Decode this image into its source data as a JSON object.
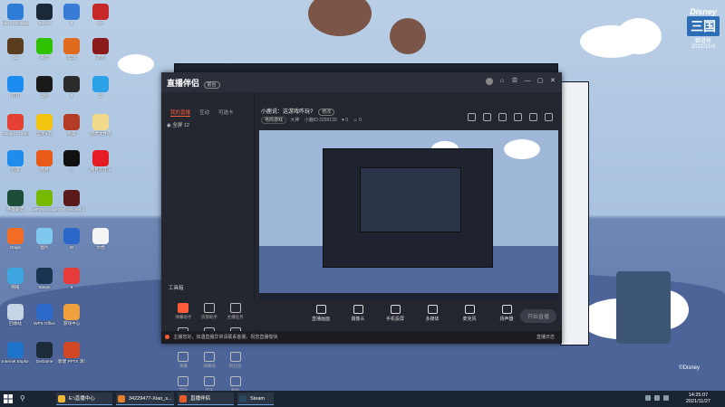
{
  "wallpaper": {
    "brand_line1": "Disney",
    "brand_line2": "三国",
    "brand_line3": "御道将",
    "brand_date": "2021/11/4",
    "copyright": "©Disney"
  },
  "desktop_icons": [
    {
      "label": "Microsoft Edge",
      "color": "#2f7cd6"
    },
    {
      "label": "Steam",
      "color": "#1b2838"
    },
    {
      "label": "8",
      "color": "#3a7bd5"
    },
    {
      "label": "CF",
      "color": "#c62828"
    },
    {
      "label": "SE",
      "color": "#5c3d1e"
    },
    {
      "label": "微信",
      "color": "#2dc100"
    },
    {
      "label": "篮球",
      "color": "#e06b1f"
    },
    {
      "label": "游戏",
      "color": "#8b1a1a"
    },
    {
      "label": "钉钉",
      "color": "#1c8cf0"
    },
    {
      "label": "QQ",
      "color": "#1a1a1a"
    },
    {
      "label": "5",
      "color": "#2b2b2b"
    },
    {
      "label": "Q",
      "color": "#2da1e6"
    },
    {
      "label": "Google Chrome",
      "color": "#e44134"
    },
    {
      "label": "全民K歌",
      "color": "#f2c40f"
    },
    {
      "label": "英雄",
      "color": "#b43c25"
    },
    {
      "label": "新建文件夹",
      "color": "#f3d98a"
    },
    {
      "label": "迅雷",
      "color": "#1f8ceb"
    },
    {
      "label": "网易",
      "color": "#e85a16"
    },
    {
      "label": "C",
      "color": "#111111"
    },
    {
      "label": "网易云音乐",
      "color": "#e51c23"
    },
    {
      "label": "英雄联盟",
      "color": "#1d4e3a"
    },
    {
      "label": "GeForce Experience",
      "color": "#76b900"
    },
    {
      "label": "The Witcher 3",
      "color": "#5a1a1a"
    },
    {
      "label": "WPS",
      "color": "#eeeeee"
    },
    {
      "label": "Origin",
      "color": "#f26c23"
    },
    {
      "label": "图片",
      "color": "#7ec8f0"
    },
    {
      "label": "W",
      "color": "#2b66c9"
    },
    {
      "label": "文档",
      "color": "#f5f5f5"
    },
    {
      "label": "网络",
      "color": "#3da5e0"
    },
    {
      "label": "Steam",
      "color": "#1a3350"
    },
    {
      "label": "6",
      "color": "#e63c3c"
    },
    {
      "label": "回收站",
      "color": "#c7d4e6"
    },
    {
      "label": "WPS Office",
      "color": "#2e6ac9"
    },
    {
      "label": "游戏中心",
      "color": "#f0a03c"
    },
    {
      "label": "新建 PPT",
      "color": "#e35b2b"
    },
    {
      "label": "Internet Explorer",
      "color": "#1e74c9"
    },
    {
      "label": "GeGame",
      "color": "#1d2a3a"
    },
    {
      "label": "新建 PPTX 演示文稿",
      "color": "#d24726"
    }
  ],
  "app": {
    "logo": "直播伴侣",
    "badge": "前台",
    "window_controls": [
      "⌂",
      "☰",
      "—",
      "▢",
      "✕"
    ],
    "sidebar": {
      "tabs": [
        "我的直播",
        "互动",
        "可选卡"
      ],
      "active_tab": "我的直播",
      "scene": "全屏 12",
      "tools_title": "工具箱",
      "tools": [
        "弹幕助手",
        "房管助手",
        "主播任务",
        "礼物设置",
        "送礼互动",
        "连麦PK",
        "弹幕",
        "弹幕墙",
        "粉丝团",
        "游戏",
        "音乐",
        "数据"
      ]
    },
    "header": {
      "question": "小鹿说：这游戏咋玩?",
      "edit": "修改",
      "tag": "电商游戏",
      "category": "大神",
      "room_id": "小鹿ID:2299133",
      "likes": "0",
      "fans": "0"
    },
    "bottom_buttons": [
      "直播画面",
      "摄像头",
      "手机投屏",
      "多媒体",
      "麦克风",
      "扬声器"
    ],
    "start_live": "开始直播",
    "notice": "主播您好，如遇直播异常请联系客服，祝您直播愉快",
    "notice_right": "直播日志"
  },
  "taskbar": {
    "search_icon": "search-icon",
    "items": [
      {
        "label": "E:\\直播中心",
        "color": "#f0b838"
      },
      {
        "label": "34229477-Xiao_s...",
        "color": "#e08030"
      },
      {
        "label": "直播伴侣",
        "color": "#e65c2c"
      },
      {
        "label": "Steam",
        "color": "#2a475e"
      }
    ],
    "time": "14:25:07",
    "date": "2021/11/27"
  }
}
